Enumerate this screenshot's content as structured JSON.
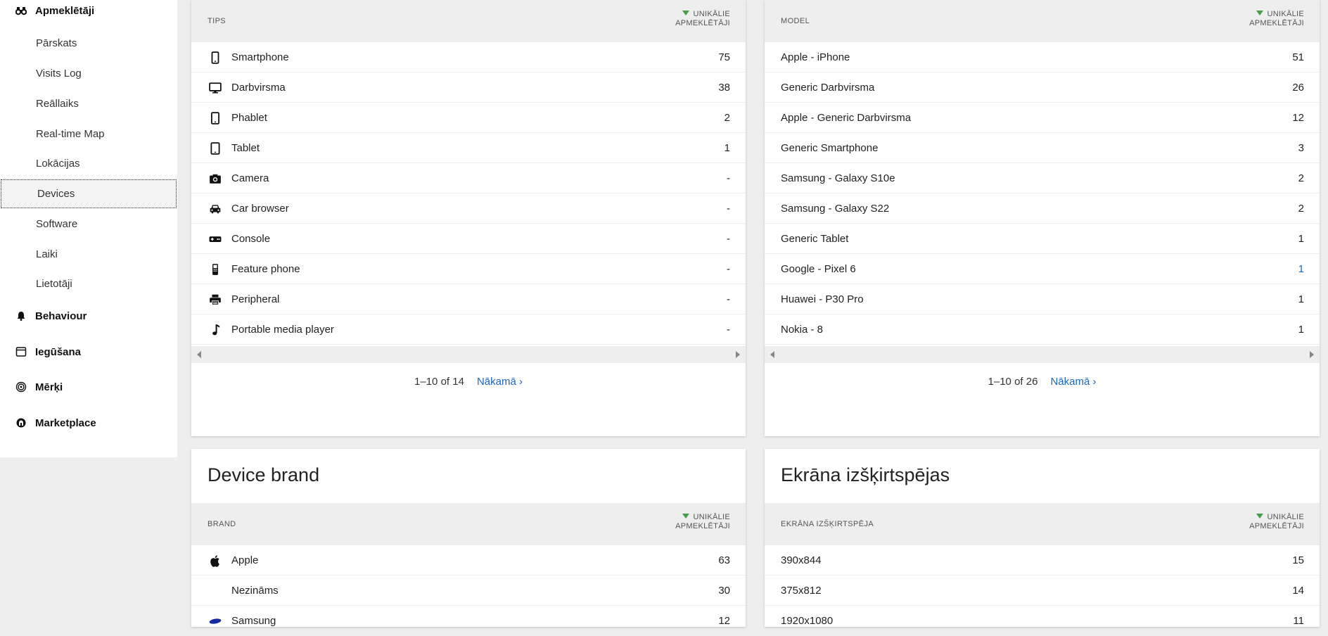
{
  "sidebar": {
    "visitors_label": "Apmeklētāji",
    "items": [
      {
        "label": "Pārskats"
      },
      {
        "label": "Visits Log"
      },
      {
        "label": "Reāllaiks"
      },
      {
        "label": "Real-time Map"
      },
      {
        "label": "Lokācijas"
      },
      {
        "label": "Devices"
      },
      {
        "label": "Software"
      },
      {
        "label": "Laiki"
      },
      {
        "label": "Lietotāji"
      }
    ],
    "behaviour_label": "Behaviour",
    "acquisition_label": "Iegūšana",
    "goals_label": "Mērķi",
    "marketplace_label": "Marketplace"
  },
  "device_type": {
    "col_label": "TIPS",
    "metric_line1": "UNIKĀLIE",
    "metric_line2": "APMEKLĒTĀJI",
    "rows": [
      {
        "icon": "smartphone-icon",
        "label": "Smartphone",
        "value": "75"
      },
      {
        "icon": "desktop-icon",
        "label": "Darbvirsma",
        "value": "38"
      },
      {
        "icon": "phablet-icon",
        "label": "Phablet",
        "value": "2"
      },
      {
        "icon": "tablet-icon",
        "label": "Tablet",
        "value": "1"
      },
      {
        "icon": "camera-icon",
        "label": "Camera",
        "value": "-"
      },
      {
        "icon": "car-icon",
        "label": "Car browser",
        "value": "-"
      },
      {
        "icon": "console-icon",
        "label": "Console",
        "value": "-"
      },
      {
        "icon": "feature-phone-icon",
        "label": "Feature phone",
        "value": "-"
      },
      {
        "icon": "printer-icon",
        "label": "Peripheral",
        "value": "-"
      },
      {
        "icon": "music-note-icon",
        "label": "Portable media player",
        "value": "-"
      }
    ],
    "range": "1–10 of 14",
    "next": "Nākamā ›"
  },
  "device_model": {
    "col_label": "MODEL",
    "metric_line1": "UNIKĀLIE",
    "metric_line2": "APMEKLĒTĀJI",
    "rows": [
      {
        "label": "Apple - iPhone",
        "value": "51"
      },
      {
        "label": "Generic Darbvirsma",
        "value": "26"
      },
      {
        "label": "Apple - Generic Darbvirsma",
        "value": "12"
      },
      {
        "label": "Generic Smartphone",
        "value": "3"
      },
      {
        "label": "Samsung - Galaxy S10e",
        "value": "2"
      },
      {
        "label": "Samsung - Galaxy S22",
        "value": "2"
      },
      {
        "label": "Generic Tablet",
        "value": "1"
      },
      {
        "label": "Google - Pixel 6",
        "value": "1"
      },
      {
        "label": "Huawei - P30 Pro",
        "value": "1"
      },
      {
        "label": "Nokia - 8",
        "value": "1"
      }
    ],
    "range": "1–10 of 26",
    "next": "Nākamā ›"
  },
  "device_brand": {
    "title": "Device brand",
    "col_label": "BRAND",
    "metric_line1": "UNIKĀLIE",
    "metric_line2": "APMEKLĒTĀJI",
    "rows": [
      {
        "icon": "apple-logo-icon",
        "label": "Apple",
        "value": "63"
      },
      {
        "icon": "",
        "label": "Nezināms",
        "value": "30"
      },
      {
        "icon": "samsung-logo-icon",
        "label": "Samsung",
        "value": "12"
      }
    ]
  },
  "screen_resolution": {
    "title": "Ekrāna izšķirtspējas",
    "col_label": "EKRĀNA IZŠĶIRTSPĒJA",
    "metric_line1": "UNIKĀLIE",
    "metric_line2": "APMEKLĒTĀJI",
    "rows": [
      {
        "label": "390x844",
        "value": "15"
      },
      {
        "label": "375x812",
        "value": "14"
      },
      {
        "label": "1920x1080",
        "value": "11"
      }
    ]
  },
  "colors": {
    "accent_link": "#1a66c0",
    "sort_arrow": "#43a047",
    "page_bg": "#eeeeef"
  }
}
